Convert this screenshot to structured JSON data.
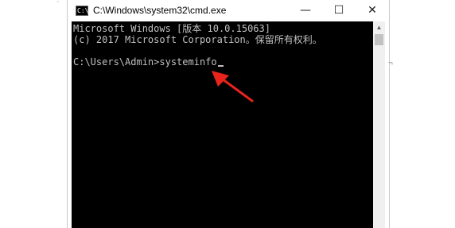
{
  "window": {
    "title": "C:\\Windows\\system32\\cmd.exe",
    "icon": "cmd-app-icon",
    "controls": {
      "minimize": "—",
      "maximize": "☐",
      "close": "✕"
    }
  },
  "console": {
    "lines": [
      "Microsoft Windows [版本 10.0.15063]",
      "(c) 2017 Microsoft Corporation。保留所有权利。",
      "",
      "C:\\Users\\Admin>systeminfo"
    ]
  },
  "annotation": {
    "icon": "red-arrow-pointer",
    "color": "#e8241c"
  }
}
